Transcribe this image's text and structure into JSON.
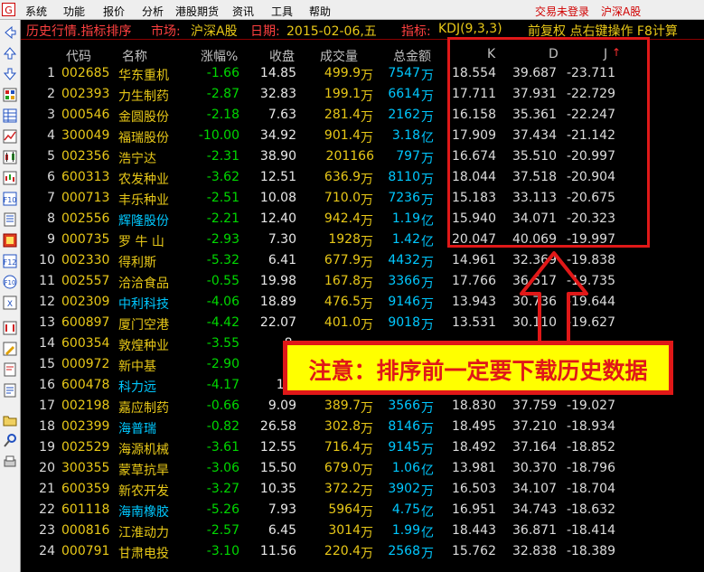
{
  "menu": [
    "系统",
    "功能",
    "报价",
    "分析",
    "港股期货",
    "资讯",
    "工具",
    "帮助"
  ],
  "menu_right": {
    "trade": "交易未登录",
    "market": "沪深A股"
  },
  "title": {
    "prefix": "历史行情.指标排序",
    "market_label": "市场:",
    "market_value": "沪深A股",
    "date_label": "日期:",
    "date_value": "2015-02-06,五",
    "indicator_label": "指标:",
    "indicator_value": "KDJ(9,3,3)",
    "hint": "前复权 点右键操作 F8计算"
  },
  "columns": {
    "code": "代码",
    "name": "名称",
    "change": "涨幅%",
    "close": "收盘",
    "volume": "成交量",
    "amount": "总金额",
    "k": "K",
    "d": "D",
    "j": "J"
  },
  "sort_arrow": "↑",
  "rows": [
    {
      "idx": "1",
      "code": "002685",
      "name": "华东重机",
      "nc": "y",
      "chg": "-1.66",
      "close": "14.85",
      "vol": "499.9",
      "vu": "万",
      "amt": "7547",
      "au": "万",
      "k": "18.554",
      "d": "39.687",
      "j": "-23.711"
    },
    {
      "idx": "2",
      "code": "002393",
      "name": "力生制药",
      "nc": "y",
      "chg": "-2.87",
      "close": "32.83",
      "vol": "199.1",
      "vu": "万",
      "amt": "6614",
      "au": "万",
      "k": "17.711",
      "d": "37.931",
      "j": "-22.729"
    },
    {
      "idx": "3",
      "code": "000546",
      "name": "金圆股份",
      "nc": "y",
      "chg": "-2.18",
      "close": "7.63",
      "vol": "281.4",
      "vu": "万",
      "amt": "2162",
      "au": "万",
      "k": "16.158",
      "d": "35.361",
      "j": "-22.247"
    },
    {
      "idx": "4",
      "code": "300049",
      "name": "福瑞股份",
      "nc": "y",
      "chg": "-10.00",
      "close": "34.92",
      "vol": "901.4",
      "vu": "万",
      "amt": "3.18",
      "au": "亿",
      "k": "17.909",
      "d": "37.434",
      "j": "-21.142"
    },
    {
      "idx": "5",
      "code": "002356",
      "name": "浩宁达",
      "nc": "y",
      "chg": "-2.31",
      "close": "38.90",
      "vol": "201166",
      "vu": "",
      "amt": "797",
      "au": "万",
      "k": "16.674",
      "d": "35.510",
      "j": "-20.997"
    },
    {
      "idx": "6",
      "code": "600313",
      "name": "农发种业",
      "nc": "y",
      "chg": "-3.62",
      "close": "12.51",
      "vol": "636.9",
      "vu": "万",
      "amt": "8110",
      "au": "万",
      "k": "18.044",
      "d": "37.518",
      "j": "-20.904"
    },
    {
      "idx": "7",
      "code": "000713",
      "name": "丰乐种业",
      "nc": "y",
      "chg": "-2.51",
      "close": "10.08",
      "vol": "710.0",
      "vu": "万",
      "amt": "7236",
      "au": "万",
      "k": "15.183",
      "d": "33.113",
      "j": "-20.675"
    },
    {
      "idx": "8",
      "code": "002556",
      "name": "辉隆股份",
      "nc": "c",
      "chg": "-2.21",
      "close": "12.40",
      "vol": "942.4",
      "vu": "万",
      "amt": "1.19",
      "au": "亿",
      "k": "15.940",
      "d": "34.071",
      "j": "-20.323"
    },
    {
      "idx": "9",
      "code": "000735",
      "name": "罗 牛 山",
      "nc": "y",
      "chg": "-2.93",
      "close": "7.30",
      "vol": "1928",
      "vu": "万",
      "amt": "1.42",
      "au": "亿",
      "k": "20.047",
      "d": "40.069",
      "j": "-19.997"
    },
    {
      "idx": "10",
      "code": "002330",
      "name": "得利斯",
      "nc": "y",
      "chg": "-5.32",
      "close": "6.41",
      "vol": "677.9",
      "vu": "万",
      "amt": "4432",
      "au": "万",
      "k": "14.961",
      "d": "32.369",
      "j": "-19.838"
    },
    {
      "idx": "11",
      "code": "002557",
      "name": "洽洽食品",
      "nc": "y",
      "chg": "-0.55",
      "close": "19.98",
      "vol": "167.8",
      "vu": "万",
      "amt": "3366",
      "au": "万",
      "k": "17.766",
      "d": "36.517",
      "j": "-19.735"
    },
    {
      "idx": "12",
      "code": "002309",
      "name": "中利科技",
      "nc": "c",
      "chg": "-4.06",
      "close": "18.89",
      "vol": "476.5",
      "vu": "万",
      "amt": "9146",
      "au": "万",
      "k": "13.943",
      "d": "30.736",
      "j": "-19.644"
    },
    {
      "idx": "13",
      "code": "600897",
      "name": "厦门空港",
      "nc": "y",
      "chg": "-4.42",
      "close": "22.07",
      "vol": "401.0",
      "vu": "万",
      "amt": "9018",
      "au": "万",
      "k": "13.531",
      "d": "30.110",
      "j": "-19.627"
    },
    {
      "idx": "14",
      "code": "600354",
      "name": "敦煌种业",
      "nc": "y",
      "chg": "-3.55",
      "close": "8.",
      "vol": "",
      "vu": "",
      "amt": "",
      "au": "",
      "k": "",
      "d": "",
      "j": ""
    },
    {
      "idx": "15",
      "code": "000972",
      "name": "新中基",
      "nc": "y",
      "chg": "-2.90",
      "close": "5.",
      "vol": "",
      "vu": "",
      "amt": "",
      "au": "",
      "k": "",
      "d": "",
      "j": ""
    },
    {
      "idx": "16",
      "code": "600478",
      "name": "科力远",
      "nc": "c",
      "chg": "-4.17",
      "close": "19.",
      "vol": "",
      "vu": "",
      "amt": "",
      "au": "",
      "k": "",
      "d": "",
      "j": ""
    },
    {
      "idx": "17",
      "code": "002198",
      "name": "嘉应制药",
      "nc": "y",
      "chg": "-0.66",
      "close": "9.09",
      "vol": "389.7",
      "vu": "万",
      "amt": "3566",
      "au": "万",
      "k": "18.830",
      "d": "37.759",
      "j": "-19.027"
    },
    {
      "idx": "18",
      "code": "002399",
      "name": "海普瑞",
      "nc": "c",
      "chg": "-0.82",
      "close": "26.58",
      "vol": "302.8",
      "vu": "万",
      "amt": "8146",
      "au": "万",
      "k": "18.495",
      "d": "37.210",
      "j": "-18.934"
    },
    {
      "idx": "19",
      "code": "002529",
      "name": "海源机械",
      "nc": "y",
      "chg": "-3.61",
      "close": "12.55",
      "vol": "716.4",
      "vu": "万",
      "amt": "9145",
      "au": "万",
      "k": "18.492",
      "d": "37.164",
      "j": "-18.852"
    },
    {
      "idx": "20",
      "code": "300355",
      "name": "蒙草抗旱",
      "nc": "y",
      "chg": "-3.06",
      "close": "15.50",
      "vol": "679.0",
      "vu": "万",
      "amt": "1.06",
      "au": "亿",
      "k": "13.981",
      "d": "30.370",
      "j": "-18.796"
    },
    {
      "idx": "21",
      "code": "600359",
      "name": "新农开发",
      "nc": "y",
      "chg": "-3.27",
      "close": "10.35",
      "vol": "372.2",
      "vu": "万",
      "amt": "3902",
      "au": "万",
      "k": "16.503",
      "d": "34.107",
      "j": "-18.704"
    },
    {
      "idx": "22",
      "code": "601118",
      "name": "海南橡胶",
      "nc": "c",
      "chg": "-5.26",
      "close": "7.93",
      "vol": "5964",
      "vu": "万",
      "amt": "4.75",
      "au": "亿",
      "k": "16.951",
      "d": "34.743",
      "j": "-18.632"
    },
    {
      "idx": "23",
      "code": "000816",
      "name": "江淮动力",
      "nc": "y",
      "chg": "-2.57",
      "close": "6.45",
      "vol": "3014",
      "vu": "万",
      "amt": "1.99",
      "au": "亿",
      "k": "18.443",
      "d": "36.871",
      "j": "-18.414"
    },
    {
      "idx": "24",
      "code": "000791",
      "name": "甘肃电投",
      "nc": "y",
      "chg": "-3.10",
      "close": "11.56",
      "vol": "220.4",
      "vu": "万",
      "amt": "2568",
      "au": "万",
      "k": "15.762",
      "d": "32.838",
      "j": "-18.389"
    }
  ],
  "notice": "注意：排序前一定要下载历史数据",
  "colors": {
    "red": "#e01818",
    "yellow": "#ffff00",
    "green": "#00d800",
    "cyan": "#00c8ff",
    "gold": "#e8c818"
  },
  "toolbar_icons": [
    "back-icon",
    "up-icon",
    "down-icon",
    "quote-icon",
    "table-icon",
    "chart-icon",
    "candlestick-icon",
    "kline-icon",
    "f10-icon",
    "news-icon",
    "info-icon",
    "f12-icon",
    "f10-round-icon",
    "indicator-icon",
    "sort-icon",
    "edit-icon",
    "report-icon",
    "report2-icon",
    "folder-icon",
    "tools-icon",
    "print-icon"
  ]
}
